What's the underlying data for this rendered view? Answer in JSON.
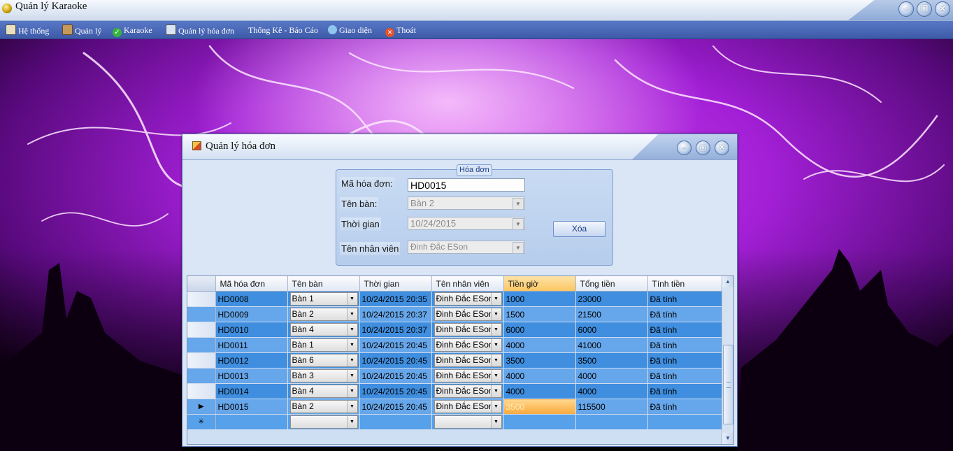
{
  "app": {
    "title": "Quản lý Karaoke"
  },
  "menu": [
    {
      "label": "Hệ thống",
      "icon": "system-icon",
      "color": "#e8e0c0"
    },
    {
      "label": "Quản lý",
      "icon": "book-icon",
      "color": "#c49a5c"
    },
    {
      "label": "Karaoke",
      "icon": "check-icon",
      "color": "#38b43c"
    },
    {
      "label": "Quản lý hóa đơn",
      "icon": "invoice-icon",
      "color": "#d8e4f4"
    },
    {
      "label": "Thống Kê - Báo Cáo",
      "icon": "",
      "color": ""
    },
    {
      "label": "Giao diện",
      "icon": "theme-icon",
      "color": "#8fc6f0"
    },
    {
      "label": "Thoát",
      "icon": "exit-icon",
      "color": "#e2542e"
    }
  ],
  "dialog": {
    "title": "Quản lý hóa đơn",
    "group_title": "Hóa đơn",
    "fields": {
      "ma_hoa_don": {
        "label": "Mã hóa đơn:",
        "value": "HD0015"
      },
      "ten_ban": {
        "label": "Tên bàn:",
        "value": "Bàn 2"
      },
      "thoi_gian": {
        "label": "Thời gian",
        "value": "10/24/2015"
      },
      "ten_nhan_vien": {
        "label": "Tên nhân viên",
        "value": "Đinh Đắc ESon"
      }
    },
    "delete_button": "Xóa"
  },
  "grid": {
    "columns": [
      "Mã hóa đơn",
      "Tên bàn",
      "Thời gian",
      "Tên nhân viên",
      "Tiền giờ",
      "Tổng tiền",
      "Tính tiền"
    ],
    "rows": [
      {
        "ma": "HD0008",
        "ban": "Bàn 1",
        "thoigian": "10/24/2015 20:35",
        "nhanvien": "Đinh Đắc ESon",
        "tiengio": "1000",
        "tongtien": "23000",
        "tinhtien": "Đã tính"
      },
      {
        "ma": "HD0009",
        "ban": "Bàn 2",
        "thoigian": "10/24/2015 20:37",
        "nhanvien": "Đinh Đắc ESon",
        "tiengio": "1500",
        "tongtien": "21500",
        "tinhtien": "Đã tính"
      },
      {
        "ma": "HD0010",
        "ban": "Bàn 4",
        "thoigian": "10/24/2015 20:37",
        "nhanvien": "Đinh Đắc ESon",
        "tiengio": "6000",
        "tongtien": "6000",
        "tinhtien": "Đã tính"
      },
      {
        "ma": "HD0011",
        "ban": "Bàn 1",
        "thoigian": "10/24/2015 20:45",
        "nhanvien": "Đinh Đắc ESon",
        "tiengio": "4000",
        "tongtien": "41000",
        "tinhtien": "Đã tính"
      },
      {
        "ma": "HD0012",
        "ban": "Bàn 6",
        "thoigian": "10/24/2015 20:45",
        "nhanvien": "Đinh Đắc ESon",
        "tiengio": "3500",
        "tongtien": "3500",
        "tinhtien": "Đã tính"
      },
      {
        "ma": "HD0013",
        "ban": "Bàn 3",
        "thoigian": "10/24/2015 20:45",
        "nhanvien": "Đinh Đắc ESon",
        "tiengio": "4000",
        "tongtien": "4000",
        "tinhtien": "Đã tính"
      },
      {
        "ma": "HD0014",
        "ban": "Bàn 4",
        "thoigian": "10/24/2015 20:45",
        "nhanvien": "Đinh Đắc ESon",
        "tiengio": "4000",
        "tongtien": "4000",
        "tinhtien": "Đã tính"
      },
      {
        "ma": "HD0015",
        "ban": "Bàn 2",
        "thoigian": "10/24/2015 20:45",
        "nhanvien": "Đinh Đắc ESon",
        "tiengio": "3500",
        "tongtien": "115500",
        "tinhtien": "Đã tính"
      }
    ],
    "current_row_marker": "▶",
    "new_row_marker": "✳"
  }
}
